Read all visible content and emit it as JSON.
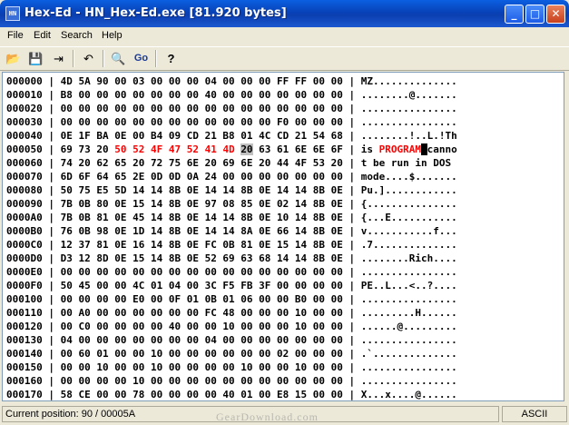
{
  "window": {
    "title": "Hex-Ed - HN_Hex-Ed.exe [81.920 bytes]",
    "app_icon_text": "HN",
    "icon": "hex-editor-app-icon",
    "minimize_glyph": "_",
    "maximize_glyph": "□",
    "close_glyph": "✕"
  },
  "menu": [
    "File",
    "Edit",
    "Search",
    "Help"
  ],
  "toolbar": {
    "buttons": [
      {
        "name": "open-icon",
        "glyph": "📂"
      },
      {
        "name": "save-icon",
        "glyph": "💾"
      },
      {
        "name": "exit-icon",
        "glyph": "⇥"
      },
      {
        "name": "undo-icon",
        "glyph": "↶"
      },
      {
        "name": "find-icon",
        "glyph": "🔍"
      },
      {
        "name": "goto-icon",
        "glyph": "Go"
      },
      {
        "name": "help-icon",
        "glyph": "?"
      }
    ]
  },
  "colors": {
    "highlight_text": "#ff0000",
    "selected_byte_bg": "#c0c0c0",
    "cursor_bg": "#000000"
  },
  "hex_rows": [
    {
      "addr": "000000",
      "bytes": "4D 5A 90 00 03 00 00 00 04 00 00 00 FF FF 00 00",
      "ascii": "MZ.............."
    },
    {
      "addr": "000010",
      "bytes": "B8 00 00 00 00 00 00 00 40 00 00 00 00 00 00 00",
      "ascii": "........@......."
    },
    {
      "addr": "000020",
      "bytes": "00 00 00 00 00 00 00 00 00 00 00 00 00 00 00 00",
      "ascii": "................"
    },
    {
      "addr": "000030",
      "bytes": "00 00 00 00 00 00 00 00 00 00 00 00 F0 00 00 00",
      "ascii": "................"
    },
    {
      "addr": "000040",
      "bytes": "0E 1F BA 0E 00 B4 09 CD 21 B8 01 4C CD 21 54 68",
      "ascii": "........!..L.!Th"
    },
    {
      "addr": "000050",
      "bytes_pre": "69 73 20 ",
      "bytes_red": "50 52 4F 47 52 41 4D",
      "bytes_sel": "20",
      "bytes_post": " 63 61 6E 6E 6F",
      "ascii_pre": "is ",
      "ascii_red": "PROGRAM",
      "ascii_cur": " ",
      "ascii_post": "canno"
    },
    {
      "addr": "000060",
      "bytes": "74 20 62 65 20 72 75 6E 20 69 6E 20 44 4F 53 20",
      "ascii": "t be run in DOS "
    },
    {
      "addr": "000070",
      "bytes": "6D 6F 64 65 2E 0D 0D 0A 24 00 00 00 00 00 00 00",
      "ascii": "mode....$......."
    },
    {
      "addr": "000080",
      "bytes": "50 75 E5 5D 14 14 8B 0E 14 14 8B 0E 14 14 8B 0E",
      "ascii": "Pu.]............"
    },
    {
      "addr": "000090",
      "bytes": "7B 0B 80 0E 15 14 8B 0E 97 08 85 0E 02 14 8B 0E",
      "ascii": "{..............."
    },
    {
      "addr": "0000A0",
      "bytes": "7B 0B 81 0E 45 14 8B 0E 14 14 8B 0E 10 14 8B 0E",
      "ascii": "{...E..........."
    },
    {
      "addr": "0000B0",
      "bytes": "76 0B 98 0E 1D 14 8B 0E 14 14 8A 0E 66 14 8B 0E",
      "ascii": "v...........f..."
    },
    {
      "addr": "0000C0",
      "bytes": "12 37 81 0E 16 14 8B 0E FC 0B 81 0E 15 14 8B 0E",
      "ascii": ".7.............."
    },
    {
      "addr": "0000D0",
      "bytes": "D3 12 8D 0E 15 14 8B 0E 52 69 63 68 14 14 8B 0E",
      "ascii": "........Rich...."
    },
    {
      "addr": "0000E0",
      "bytes": "00 00 00 00 00 00 00 00 00 00 00 00 00 00 00 00",
      "ascii": "................"
    },
    {
      "addr": "0000F0",
      "bytes": "50 45 00 00 4C 01 04 00 3C F5 FB 3F 00 00 00 00",
      "ascii": "PE..L...<..?...."
    },
    {
      "addr": "000100",
      "bytes": "00 00 00 00 E0 00 0F 01 0B 01 06 00 00 B0 00 00",
      "ascii": "................"
    },
    {
      "addr": "000110",
      "bytes": "00 A0 00 00 00 00 00 00 FC 48 00 00 00 10 00 00",
      "ascii": ".........H......"
    },
    {
      "addr": "000120",
      "bytes": "00 C0 00 00 00 00 40 00 00 10 00 00 00 10 00 00",
      "ascii": "......@........."
    },
    {
      "addr": "000130",
      "bytes": "04 00 00 00 00 00 00 00 04 00 00 00 00 00 00 00",
      "ascii": "................"
    },
    {
      "addr": "000140",
      "bytes": "00 60 01 00 00 10 00 00 00 00 00 00 02 00 00 00",
      "ascii": ".`.............."
    },
    {
      "addr": "000150",
      "bytes": "00 00 10 00 00 10 00 00 00 00 10 00 00 10 00 00",
      "ascii": "................"
    },
    {
      "addr": "000160",
      "bytes": "00 00 00 00 10 00 00 00 00 00 00 00 00 00 00 00",
      "ascii": "................"
    },
    {
      "addr": "000170",
      "bytes": "58 CE 00 00 78 00 00 00 00 40 01 00 E8 15 00 00",
      "ascii": "X...x....@......"
    }
  ],
  "status": {
    "position": "Current position: 90 / 00005A",
    "mode": "ASCII"
  },
  "watermark": "GearDownload.com"
}
